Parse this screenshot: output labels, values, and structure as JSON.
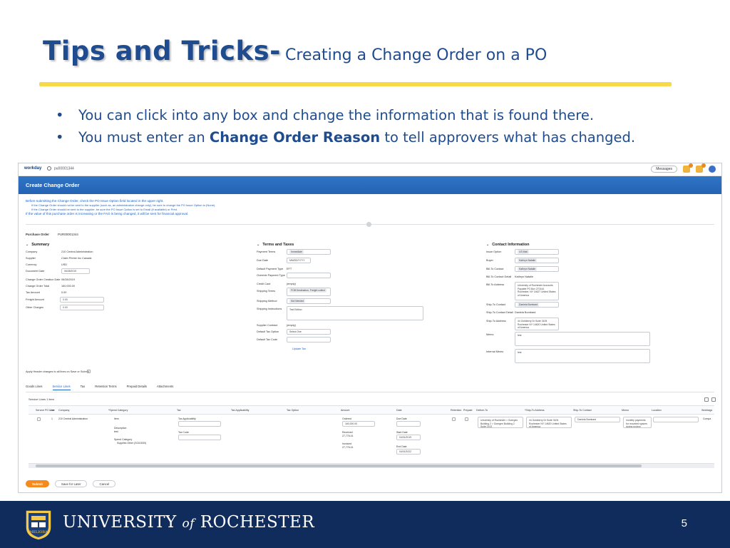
{
  "slide": {
    "title_main": "Tips and Tricks-",
    "title_sub": "Creating a Change Order on a PO",
    "bullets": [
      {
        "prefix": "You can click into any box and change the information that is found there.",
        "bold": "",
        "suffix": ""
      },
      {
        "prefix": "You must enter an ",
        "bold": "Change Order Reason",
        "suffix": " to tell approvers what has changed."
      }
    ],
    "page_number": "5",
    "footer_university": "UNIVERSITY",
    "footer_of": "of",
    "footer_rochester": "ROCHESTER",
    "seal_text": "MELIORA",
    "colors": {
      "title": "#1f4c8f",
      "rule": "#f7d94a",
      "footer": "#0f2c5c",
      "header": "#2563b3",
      "submit": "#f38b1d"
    }
  },
  "app": {
    "logo": "workday",
    "search_value": "pu00001344",
    "messages_label": "Messages",
    "page_title": "Create Change Order",
    "notice_lines": [
      "Before submitting the Change Order, check the PO Issue Option field located in the upper right.",
      "If the Change Order should not be sent to the supplier (such as, an administrative change only), be sure to change the PO Issue Option to (None).",
      "If the Change Order should be sent to the supplier, be sure the PO Issue Option is set to Email (if available) or Print.",
      "If the value of this purchase order is increasing or the FAO is being changed, it will be sent for financial approval."
    ],
    "purchase_order_label": "Purchase Order",
    "purchase_order_value": "PUR00001344",
    "summary": {
      "title": "Summary",
      "labels": [
        "Company",
        "Supplier",
        "Currency",
        "Document Date",
        "Change Order Creation Date",
        "Change Order Total",
        "Tax Amount",
        "Freight Amount",
        "Other Charges"
      ],
      "values": [
        "210 Central Administration",
        "Claim Printer Inc Canada",
        "USD",
        "06/28/2019",
        "06/28/2019",
        "160,000.00",
        "0.00",
        "0.00",
        "0.00"
      ]
    },
    "terms": {
      "title": "Terms and Taxes",
      "labels": [
        "Payment Terms",
        "Due Date",
        "Default Payment Type",
        "Override Payment Type",
        "Credit Card",
        "Shipping Terms",
        "Shipping Method",
        "Shipping Instructions",
        "Supplier Contract",
        "Default Tax Option",
        "Default Tax Code"
      ],
      "values": [
        "Immediate",
        "MM/DD/YYYY",
        "EFT",
        "",
        "(empty)",
        "FOB Destination, Freight collect",
        "Not Needed",
        "Test Edition",
        "(empty)",
        "Select One",
        ""
      ],
      "update_tax": "Update Tax"
    },
    "contact": {
      "title": "Contact Information",
      "labels": [
        "Issue Option",
        "Buyer",
        "Bill-To Contact",
        "Bill-To Contact Detail",
        "Bill-To Address",
        "Ship-To Contact",
        "Ship-To Contact Detail",
        "Ship-To Address",
        "Memo",
        "Internal Memo"
      ],
      "values": [
        "US Mail",
        "Kathryn Natalie",
        "Kathryn Natalie",
        "Kathryn Natalie",
        "University of Rochester Accounts Payable PO Box 270144 Rochester, NY 14627 United States of America",
        "Daniela Bombard",
        "Daniela Bombard",
        "44 Goldberry Dr Suite 3105 Rochester NY 14620 United States of America",
        "test",
        "test"
      ]
    },
    "apply_header": "Apply Header changes to all lines on Save or Submit",
    "tabs": [
      "Goods Lines",
      "Service Lines",
      "Tax",
      "Retention Terms",
      "Prepaid Details",
      "Attachments"
    ],
    "service_lines_label": "Service Lines  1 item",
    "grid_headers": [
      "Service PO Line",
      "Line",
      "Company",
      "*Spend Category",
      "Tax",
      "Tax Applicability",
      "Tax Option",
      "Amount",
      "Date",
      "Retention",
      "Prepaid",
      "Deliver-To",
      "*Ship-To Address",
      "Ship-To Contact",
      "Memo",
      "Location",
      "Worktags"
    ],
    "row": {
      "line": "1",
      "company": "210 Central Administration",
      "item": "Item",
      "description_label": "Description",
      "description_value": "test",
      "spend_label": "Spend Category",
      "spend_value": "Supplies Other (SC61530)",
      "tax_applicability": "Tax Applicability",
      "tax_code": "Tax Code",
      "amount_label": "Ordered",
      "amount_value": "160,000.00",
      "received_label": "Received",
      "received_value": "27,776.41",
      "invoiced_label": "Invoiced",
      "invoiced_value": "27,776.41",
      "due_date": "Due Date",
      "start_label": "Start Date",
      "start_value": "04/01/2019",
      "end_label": "End Date",
      "end_value": "04/01/2022",
      "deliver_to": "University of Rochester > Goergen Building 2 > Goergen Building 2 Suite 2102",
      "ship_to": "44 Goldberry Dr Suite 3105 Rochester NY 14620 United States of America",
      "ship_contact": "Daniela Bombard",
      "memo": "monthly payments for mounted spaces during project",
      "worktags": "Compa"
    },
    "buttons": {
      "submit": "Submit",
      "save": "Save for Later",
      "cancel": "Cancel"
    }
  }
}
